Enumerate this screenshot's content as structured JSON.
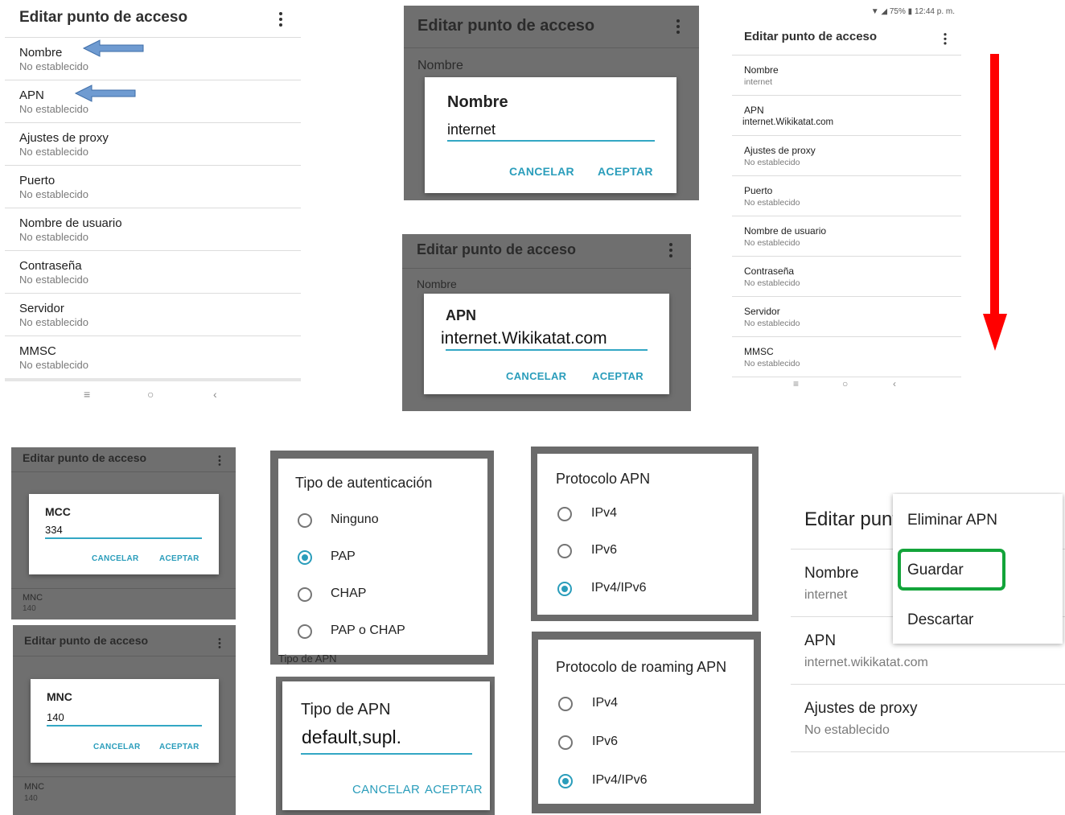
{
  "screen_title": "Editar punto de acceso",
  "screen_title_partial": "Editar punto",
  "not_set": "No establecido",
  "btn_cancel": "CANCELAR",
  "btn_accept": "ACEPTAR",
  "list_before": [
    {
      "label": "Nombre",
      "value": "No establecido"
    },
    {
      "label": "APN",
      "value": "No establecido"
    },
    {
      "label": "Ajustes de proxy",
      "value": "No establecido"
    },
    {
      "label": "Puerto",
      "value": "No establecido"
    },
    {
      "label": "Nombre de usuario",
      "value": "No establecido"
    },
    {
      "label": "Contraseña",
      "value": "No establecido"
    },
    {
      "label": "Servidor",
      "value": "No establecido"
    },
    {
      "label": "MMSC",
      "value": "No establecido"
    }
  ],
  "list_after": [
    {
      "label": "Nombre",
      "value": "internet"
    },
    {
      "label": "APN",
      "value": "internet.Wikikatat.com"
    },
    {
      "label": "Ajustes de proxy",
      "value": "No establecido"
    },
    {
      "label": "Puerto",
      "value": "No establecido"
    },
    {
      "label": "Nombre de usuario",
      "value": "No establecido"
    },
    {
      "label": "Contraseña",
      "value": "No establecido"
    },
    {
      "label": "Servidor",
      "value": "No establecido"
    },
    {
      "label": "MMSC",
      "value": "No establecido"
    }
  ],
  "status_bar": {
    "battery": "75%",
    "time": "12:44 p. m."
  },
  "nav_icons": {
    "home": "home-circle-icon",
    "back": "back-chevron-icon",
    "menu": "menu-lines-icon"
  },
  "colors": {
    "accent": "#2a9dbb",
    "arrow_red": "#ff0000",
    "arrow_blue": "#6f9bd1",
    "highlight_green": "#13a43a"
  },
  "dialog_nombre": {
    "title": "Nombre",
    "value": "internet"
  },
  "dialog_apn": {
    "title": "APN",
    "value": "internet.Wikikatat.com"
  },
  "dialog_mcc": {
    "title": "MCC",
    "value": "334"
  },
  "dialog_mnc": {
    "title": "MNC",
    "value": "140"
  },
  "dialog_apn_type": {
    "title": "Tipo de APN",
    "value": "default,supl."
  },
  "behind_mcc": {
    "label": "MNC",
    "value": "140"
  },
  "behind_mnc": {
    "label": "MNC",
    "value": "140"
  },
  "auth": {
    "title": "Tipo de autenticación",
    "peek_bottom": "Tipo de APN",
    "options": [
      "Ninguno",
      "PAP",
      "CHAP",
      "PAP o CHAP"
    ],
    "selected": 1
  },
  "protocol": {
    "title": "Protocolo APN",
    "options": [
      "IPv4",
      "IPv6",
      "IPv4/IPv6"
    ],
    "selected": 2
  },
  "roaming": {
    "title": "Protocolo de roaming APN",
    "options": [
      "IPv4",
      "IPv6",
      "IPv4/IPv6"
    ],
    "selected": 2
  },
  "save_panel": {
    "rows": [
      {
        "label": "Nombre",
        "value": "internet"
      },
      {
        "label": "APN",
        "value": "internet.wikikatat.com"
      },
      {
        "label": "Ajustes de proxy",
        "value": "No establecido"
      }
    ],
    "menu": [
      "Eliminar APN",
      "Guardar",
      "Descartar"
    ]
  }
}
